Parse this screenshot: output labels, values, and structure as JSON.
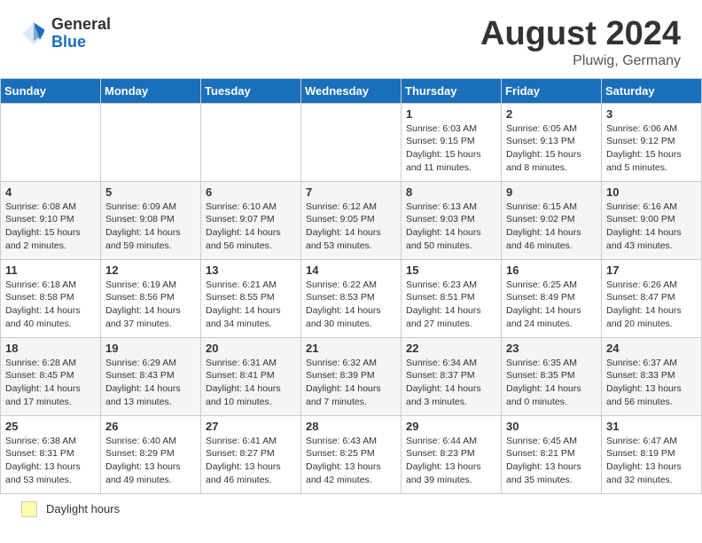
{
  "header": {
    "logo_general": "General",
    "logo_blue": "Blue",
    "month_title": "August 2024",
    "location": "Pluwig, Germany"
  },
  "footer": {
    "daylight_label": "Daylight hours"
  },
  "days_of_week": [
    "Sunday",
    "Monday",
    "Tuesday",
    "Wednesday",
    "Thursday",
    "Friday",
    "Saturday"
  ],
  "weeks": [
    {
      "days": [
        {
          "number": "",
          "info": ""
        },
        {
          "number": "",
          "info": ""
        },
        {
          "number": "",
          "info": ""
        },
        {
          "number": "",
          "info": ""
        },
        {
          "number": "1",
          "info": "Sunrise: 6:03 AM\nSunset: 9:15 PM\nDaylight: 15 hours\nand 11 minutes."
        },
        {
          "number": "2",
          "info": "Sunrise: 6:05 AM\nSunset: 9:13 PM\nDaylight: 15 hours\nand 8 minutes."
        },
        {
          "number": "3",
          "info": "Sunrise: 6:06 AM\nSunset: 9:12 PM\nDaylight: 15 hours\nand 5 minutes."
        }
      ]
    },
    {
      "days": [
        {
          "number": "4",
          "info": "Sunrise: 6:08 AM\nSunset: 9:10 PM\nDaylight: 15 hours\nand 2 minutes."
        },
        {
          "number": "5",
          "info": "Sunrise: 6:09 AM\nSunset: 9:08 PM\nDaylight: 14 hours\nand 59 minutes."
        },
        {
          "number": "6",
          "info": "Sunrise: 6:10 AM\nSunset: 9:07 PM\nDaylight: 14 hours\nand 56 minutes."
        },
        {
          "number": "7",
          "info": "Sunrise: 6:12 AM\nSunset: 9:05 PM\nDaylight: 14 hours\nand 53 minutes."
        },
        {
          "number": "8",
          "info": "Sunrise: 6:13 AM\nSunset: 9:03 PM\nDaylight: 14 hours\nand 50 minutes."
        },
        {
          "number": "9",
          "info": "Sunrise: 6:15 AM\nSunset: 9:02 PM\nDaylight: 14 hours\nand 46 minutes."
        },
        {
          "number": "10",
          "info": "Sunrise: 6:16 AM\nSunset: 9:00 PM\nDaylight: 14 hours\nand 43 minutes."
        }
      ]
    },
    {
      "days": [
        {
          "number": "11",
          "info": "Sunrise: 6:18 AM\nSunset: 8:58 PM\nDaylight: 14 hours\nand 40 minutes."
        },
        {
          "number": "12",
          "info": "Sunrise: 6:19 AM\nSunset: 8:56 PM\nDaylight: 14 hours\nand 37 minutes."
        },
        {
          "number": "13",
          "info": "Sunrise: 6:21 AM\nSunset: 8:55 PM\nDaylight: 14 hours\nand 34 minutes."
        },
        {
          "number": "14",
          "info": "Sunrise: 6:22 AM\nSunset: 8:53 PM\nDaylight: 14 hours\nand 30 minutes."
        },
        {
          "number": "15",
          "info": "Sunrise: 6:23 AM\nSunset: 8:51 PM\nDaylight: 14 hours\nand 27 minutes."
        },
        {
          "number": "16",
          "info": "Sunrise: 6:25 AM\nSunset: 8:49 PM\nDaylight: 14 hours\nand 24 minutes."
        },
        {
          "number": "17",
          "info": "Sunrise: 6:26 AM\nSunset: 8:47 PM\nDaylight: 14 hours\nand 20 minutes."
        }
      ]
    },
    {
      "days": [
        {
          "number": "18",
          "info": "Sunrise: 6:28 AM\nSunset: 8:45 PM\nDaylight: 14 hours\nand 17 minutes."
        },
        {
          "number": "19",
          "info": "Sunrise: 6:29 AM\nSunset: 8:43 PM\nDaylight: 14 hours\nand 13 minutes."
        },
        {
          "number": "20",
          "info": "Sunrise: 6:31 AM\nSunset: 8:41 PM\nDaylight: 14 hours\nand 10 minutes."
        },
        {
          "number": "21",
          "info": "Sunrise: 6:32 AM\nSunset: 8:39 PM\nDaylight: 14 hours\nand 7 minutes."
        },
        {
          "number": "22",
          "info": "Sunrise: 6:34 AM\nSunset: 8:37 PM\nDaylight: 14 hours\nand 3 minutes."
        },
        {
          "number": "23",
          "info": "Sunrise: 6:35 AM\nSunset: 8:35 PM\nDaylight: 14 hours\nand 0 minutes."
        },
        {
          "number": "24",
          "info": "Sunrise: 6:37 AM\nSunset: 8:33 PM\nDaylight: 13 hours\nand 56 minutes."
        }
      ]
    },
    {
      "days": [
        {
          "number": "25",
          "info": "Sunrise: 6:38 AM\nSunset: 8:31 PM\nDaylight: 13 hours\nand 53 minutes."
        },
        {
          "number": "26",
          "info": "Sunrise: 6:40 AM\nSunset: 8:29 PM\nDaylight: 13 hours\nand 49 minutes."
        },
        {
          "number": "27",
          "info": "Sunrise: 6:41 AM\nSunset: 8:27 PM\nDaylight: 13 hours\nand 46 minutes."
        },
        {
          "number": "28",
          "info": "Sunrise: 6:43 AM\nSunset: 8:25 PM\nDaylight: 13 hours\nand 42 minutes."
        },
        {
          "number": "29",
          "info": "Sunrise: 6:44 AM\nSunset: 8:23 PM\nDaylight: 13 hours\nand 39 minutes."
        },
        {
          "number": "30",
          "info": "Sunrise: 6:45 AM\nSunset: 8:21 PM\nDaylight: 13 hours\nand 35 minutes."
        },
        {
          "number": "31",
          "info": "Sunrise: 6:47 AM\nSunset: 8:19 PM\nDaylight: 13 hours\nand 32 minutes."
        }
      ]
    }
  ]
}
